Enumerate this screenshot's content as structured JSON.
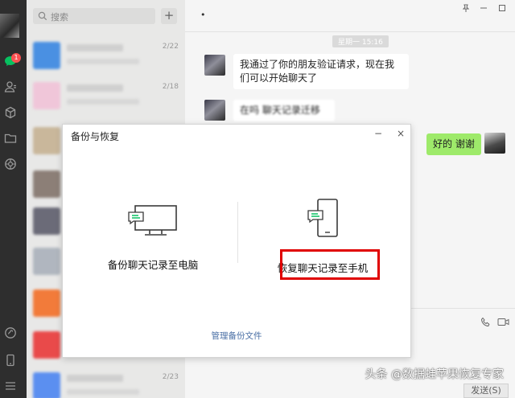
{
  "sidebar": {
    "unread_badge": "1",
    "icons": [
      "chat-icon",
      "contacts-icon",
      "cube-icon",
      "folder-icon",
      "moments-icon",
      "miniprogram-icon",
      "phone-icon",
      "menu-icon"
    ]
  },
  "list": {
    "search_placeholder": "搜索",
    "add_label": "+",
    "conversations": [
      {
        "date": "2/22",
        "color": "#4a90e2"
      },
      {
        "date": "2/18",
        "color": "#f0c6d9"
      },
      {
        "date": "",
        "color": "#c9b79b"
      },
      {
        "date": "",
        "color": "#8c7f77"
      },
      {
        "date": "",
        "color": "#6b6b78"
      },
      {
        "date": "",
        "color": "#b0b6bf"
      },
      {
        "date": "",
        "color": "#f27b3a"
      },
      {
        "date": "",
        "color": "#e94a4a"
      },
      {
        "date": "2/23",
        "color": "#5b8ff0"
      }
    ]
  },
  "chat": {
    "header_dot": "•",
    "timestamp": "星期一 15:16",
    "messages": [
      {
        "side": "left",
        "text": "我通过了你的朋友验证请求，现在我们可以开始聊天了"
      },
      {
        "side": "left",
        "text": "在吗 聊天记录迁移"
      },
      {
        "side": "right",
        "text": "好的 谢谢"
      }
    ],
    "send_label": "发送(S)"
  },
  "dialog": {
    "title": "备份与恢复",
    "close_label": "×",
    "minimize_label": "−",
    "option_backup_label": "备份聊天记录至电脑",
    "option_restore_label": "恢复聊天记录至手机",
    "manage_link": "管理备份文件"
  },
  "watermark": "头条 @数据蛙苹果恢复专家",
  "colors": {
    "accent_green": "#07c160",
    "bubble_green": "#9eea6a",
    "highlight_red": "#e00000",
    "link_blue": "#4a6fa5"
  }
}
